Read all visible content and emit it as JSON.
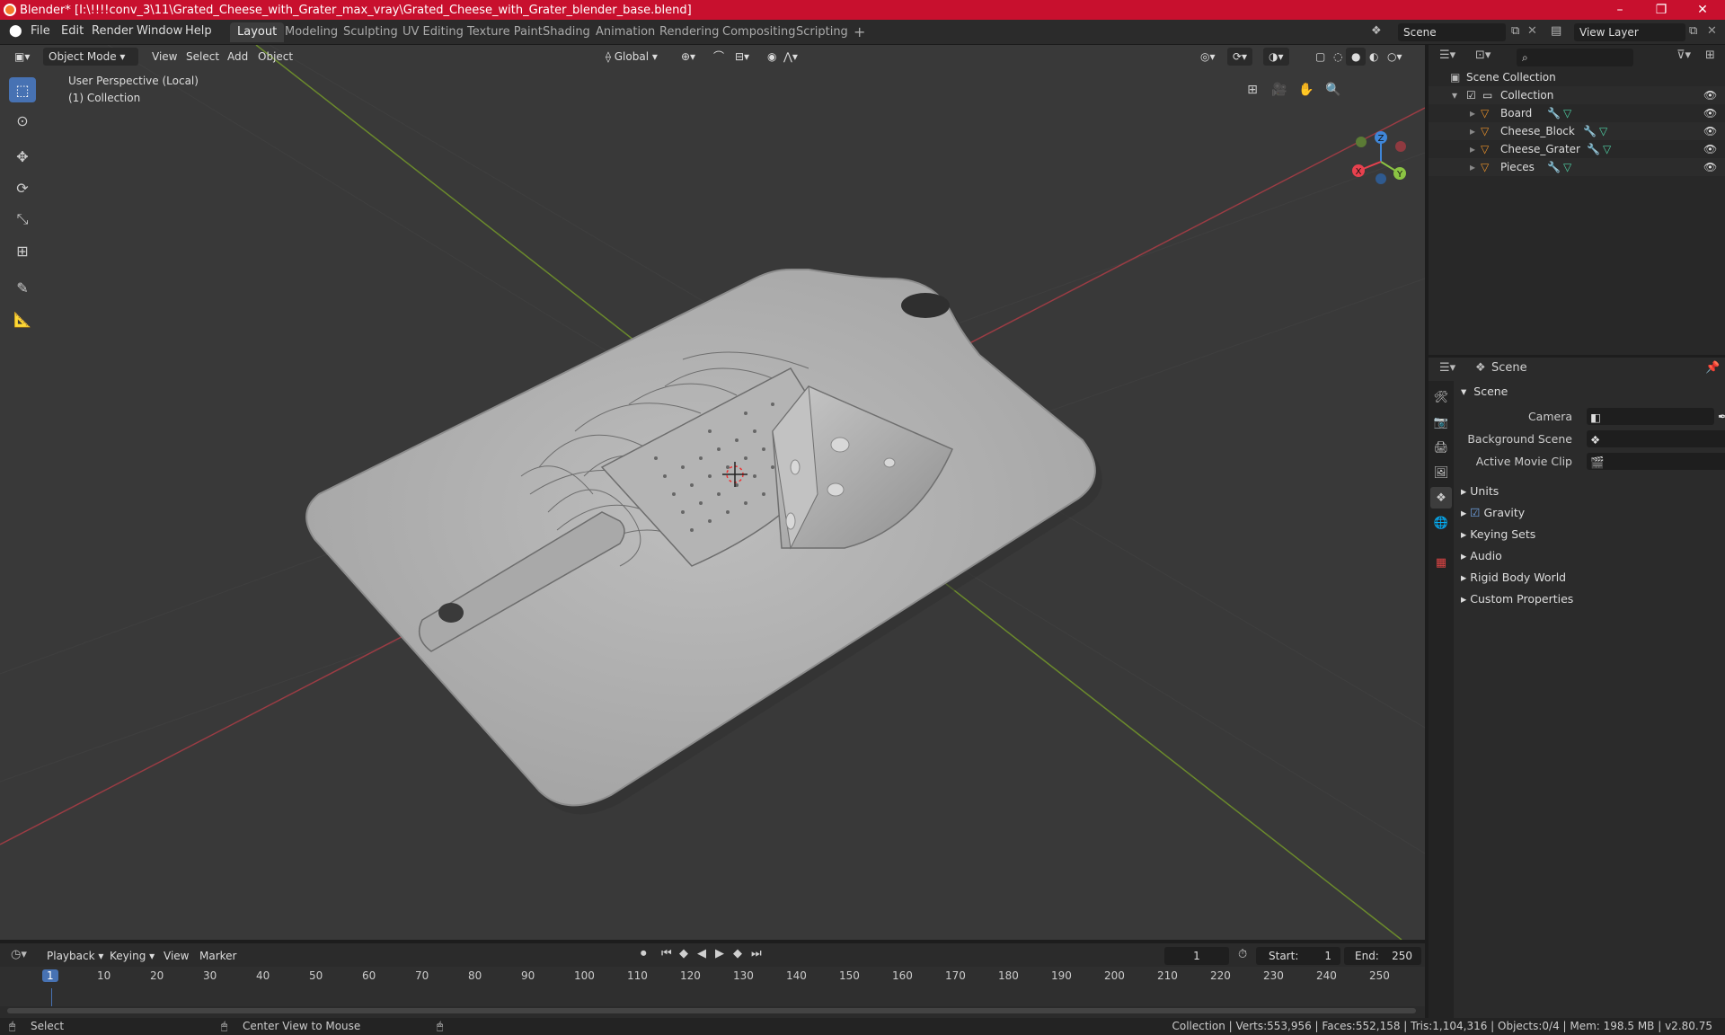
{
  "window": {
    "title": "Blender* [I:\\!!!!conv_3\\11\\Grated_Cheese_with_Grater_max_vray\\Grated_Cheese_with_Grater_blender_base.blend]",
    "minimize": "–",
    "maximize": "❐",
    "close": "✕"
  },
  "menu": [
    "File",
    "Edit",
    "Render",
    "Window",
    "Help"
  ],
  "workspaces": [
    "Layout",
    "Modeling",
    "Sculpting",
    "UV Editing",
    "Texture Paint",
    "Shading",
    "Animation",
    "Rendering",
    "Compositing",
    "Scripting"
  ],
  "add_workspace": "+",
  "scene_field": "Scene",
  "view_layer_field": "View Layer",
  "viewport": {
    "mode": "Object Mode",
    "menus": [
      "View",
      "Select",
      "Add",
      "Object"
    ],
    "orientation": "Global",
    "overlay_line1": "User Perspective (Local)",
    "overlay_line2": "(1) Collection",
    "gizmo": {
      "x": "X",
      "y": "Y",
      "z": "Z"
    }
  },
  "outliner": {
    "search_placeholder": "",
    "root": "Scene Collection",
    "collection": "Collection",
    "objects": [
      "Board",
      "Cheese_Block",
      "Cheese_Grater",
      "Pieces"
    ]
  },
  "properties": {
    "header": "Scene",
    "panel": "Scene",
    "camera_label": "Camera",
    "background_scene_label": "Background Scene",
    "active_movie_clip_label": "Active Movie Clip",
    "subpanels": [
      "Units",
      "Gravity",
      "Keying Sets",
      "Audio",
      "Rigid Body World",
      "Custom Properties"
    ]
  },
  "timeline": {
    "menus": [
      "Playback",
      "Keying",
      "View",
      "Marker"
    ],
    "current_frame": "1",
    "start_label": "Start:",
    "start": "1",
    "end_label": "End:",
    "end": "250",
    "ticks": [
      "1",
      "10",
      "20",
      "30",
      "40",
      "50",
      "60",
      "70",
      "80",
      "90",
      "100",
      "110",
      "120",
      "130",
      "140",
      "150",
      "160",
      "170",
      "180",
      "190",
      "200",
      "210",
      "220",
      "230",
      "240",
      "250"
    ]
  },
  "status": {
    "left_action": "Select",
    "mid_action": "Center View to Mouse",
    "stats": "Collection | Verts:553,956 | Faces:552,158 | Tris:1,104,316 | Objects:0/4 | Mem: 198.5 MB | v2.80.75"
  },
  "colors": {
    "titlebar": "#c8102e",
    "active_tool": "#4772b3",
    "x_axis": "#e8414e",
    "y_axis": "#8bc443",
    "z_axis": "#3f86d8",
    "object_icon": "#e8902a",
    "mesh_icon": "#4fd1a5"
  }
}
